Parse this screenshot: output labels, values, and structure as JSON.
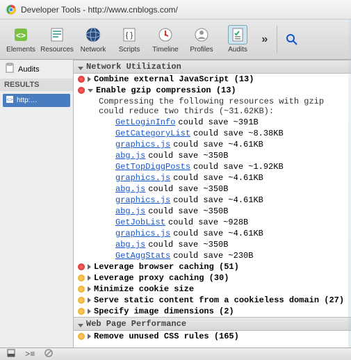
{
  "title": "Developer Tools - http://www.cnblogs.com/",
  "tabs": {
    "elements": "Elements",
    "resources": "Resources",
    "network": "Network",
    "scripts": "Scripts",
    "timeline": "Timeline",
    "profiles": "Profiles",
    "audits": "Audits"
  },
  "sidebar": {
    "audits": "Audits",
    "results": "RESULTS",
    "chip": "http:…"
  },
  "sections": {
    "net_util": "Network Utilization",
    "web_perf": "Web Page Performance"
  },
  "items": {
    "combine_js": "Combine external JavaScript (13)",
    "gzip": "Enable gzip compression (13)",
    "gzip_desc": "Compressing the following resources with gzip could reduce two thirds (~31.62KB):",
    "browser_cache": "Leverage browser caching (51)",
    "proxy_cache": "Leverage proxy caching (30)",
    "cookie": "Minimize cookie size",
    "static_cookieless": "Serve static content from a cookieless domain (27)",
    "img_dims": "Specify image dimensions (2)",
    "unused_css": "Remove unused CSS rules (165)"
  },
  "resources": [
    {
      "name": "GetLoginInfo",
      "save": " could save ~391B"
    },
    {
      "name": "GetCategoryList",
      "save": " could save ~8.38KB"
    },
    {
      "name": "graphics.js",
      "save": " could save ~4.61KB"
    },
    {
      "name": "abg.js",
      "save": " could save ~350B"
    },
    {
      "name": "GetTopDiggPosts",
      "save": " could save ~1.92KB"
    },
    {
      "name": "graphics.js",
      "save": " could save ~4.61KB"
    },
    {
      "name": "abg.js",
      "save": " could save ~350B"
    },
    {
      "name": "graphics.js",
      "save": " could save ~4.61KB"
    },
    {
      "name": "abg.js",
      "save": " could save ~350B"
    },
    {
      "name": "GetJobList",
      "save": " could save ~928B"
    },
    {
      "name": "graphics.js",
      "save": " could save ~4.61KB"
    },
    {
      "name": "abg.js",
      "save": " could save ~350B"
    },
    {
      "name": "GetAggStats",
      "save": " could save ~230B"
    }
  ]
}
